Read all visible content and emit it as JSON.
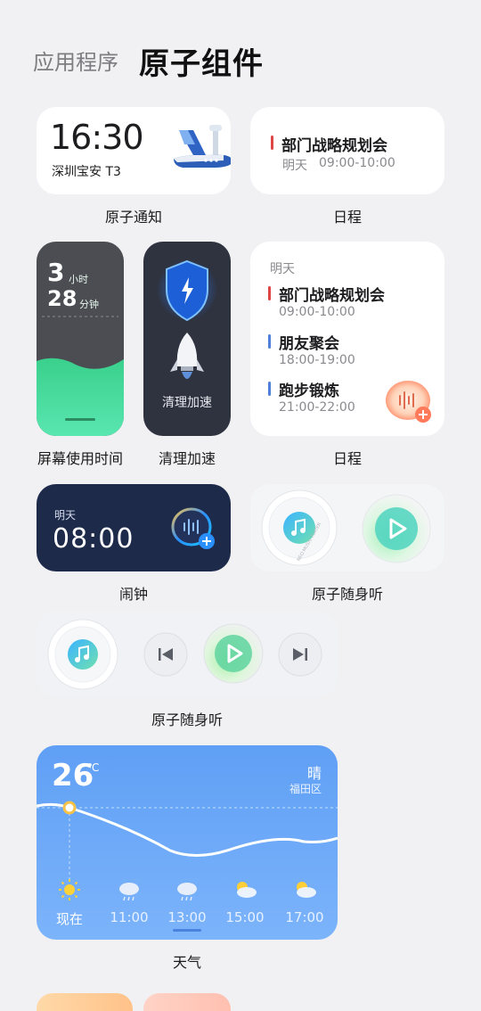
{
  "header": {
    "app_label": "应用程序",
    "page_title": "原子组件"
  },
  "notification": {
    "time": "16:30",
    "location": "深圳宝安  T3",
    "caption": "原子通知"
  },
  "schedule_small": {
    "title": "部门战略规划会",
    "date": "明天",
    "time": "09:00-10:00",
    "caption": "日程"
  },
  "screen_time": {
    "hours": "3",
    "hours_unit": "小时",
    "minutes": "28",
    "minutes_unit": "分钟",
    "caption": "屏幕使用时间"
  },
  "cleanup": {
    "label": "清理加速",
    "caption": "清理加速"
  },
  "schedule_large": {
    "day": "明天",
    "events": [
      {
        "title": "部门战略规划会",
        "time": "09:00-10:00",
        "color": "#e04545"
      },
      {
        "title": "朋友聚会",
        "time": "18:00-19:00",
        "color": "#4f7fd9"
      },
      {
        "title": "跑步锻炼",
        "time": "21:00-22:00",
        "color": "#4f7fd9"
      }
    ],
    "caption": "日程"
  },
  "alarm": {
    "day": "明天",
    "time": "08:00",
    "caption": "闹钟"
  },
  "music_small": {
    "caption": "原子随身听",
    "disc_text": "NEO MUSIC PLAYER"
  },
  "music_wide": {
    "caption": "原子随身听"
  },
  "weather": {
    "temperature": "26",
    "unit": "℃",
    "condition": "晴",
    "district": "福田区",
    "hours": [
      {
        "label": "现在",
        "icon": "sun-icon"
      },
      {
        "label": "11:00",
        "icon": "rain-icon"
      },
      {
        "label": "13:00",
        "icon": "rain-icon"
      },
      {
        "label": "15:00",
        "icon": "partly-cloudy-icon"
      },
      {
        "label": "17:00",
        "icon": "partly-cloudy-icon"
      }
    ],
    "caption": "天气"
  }
}
